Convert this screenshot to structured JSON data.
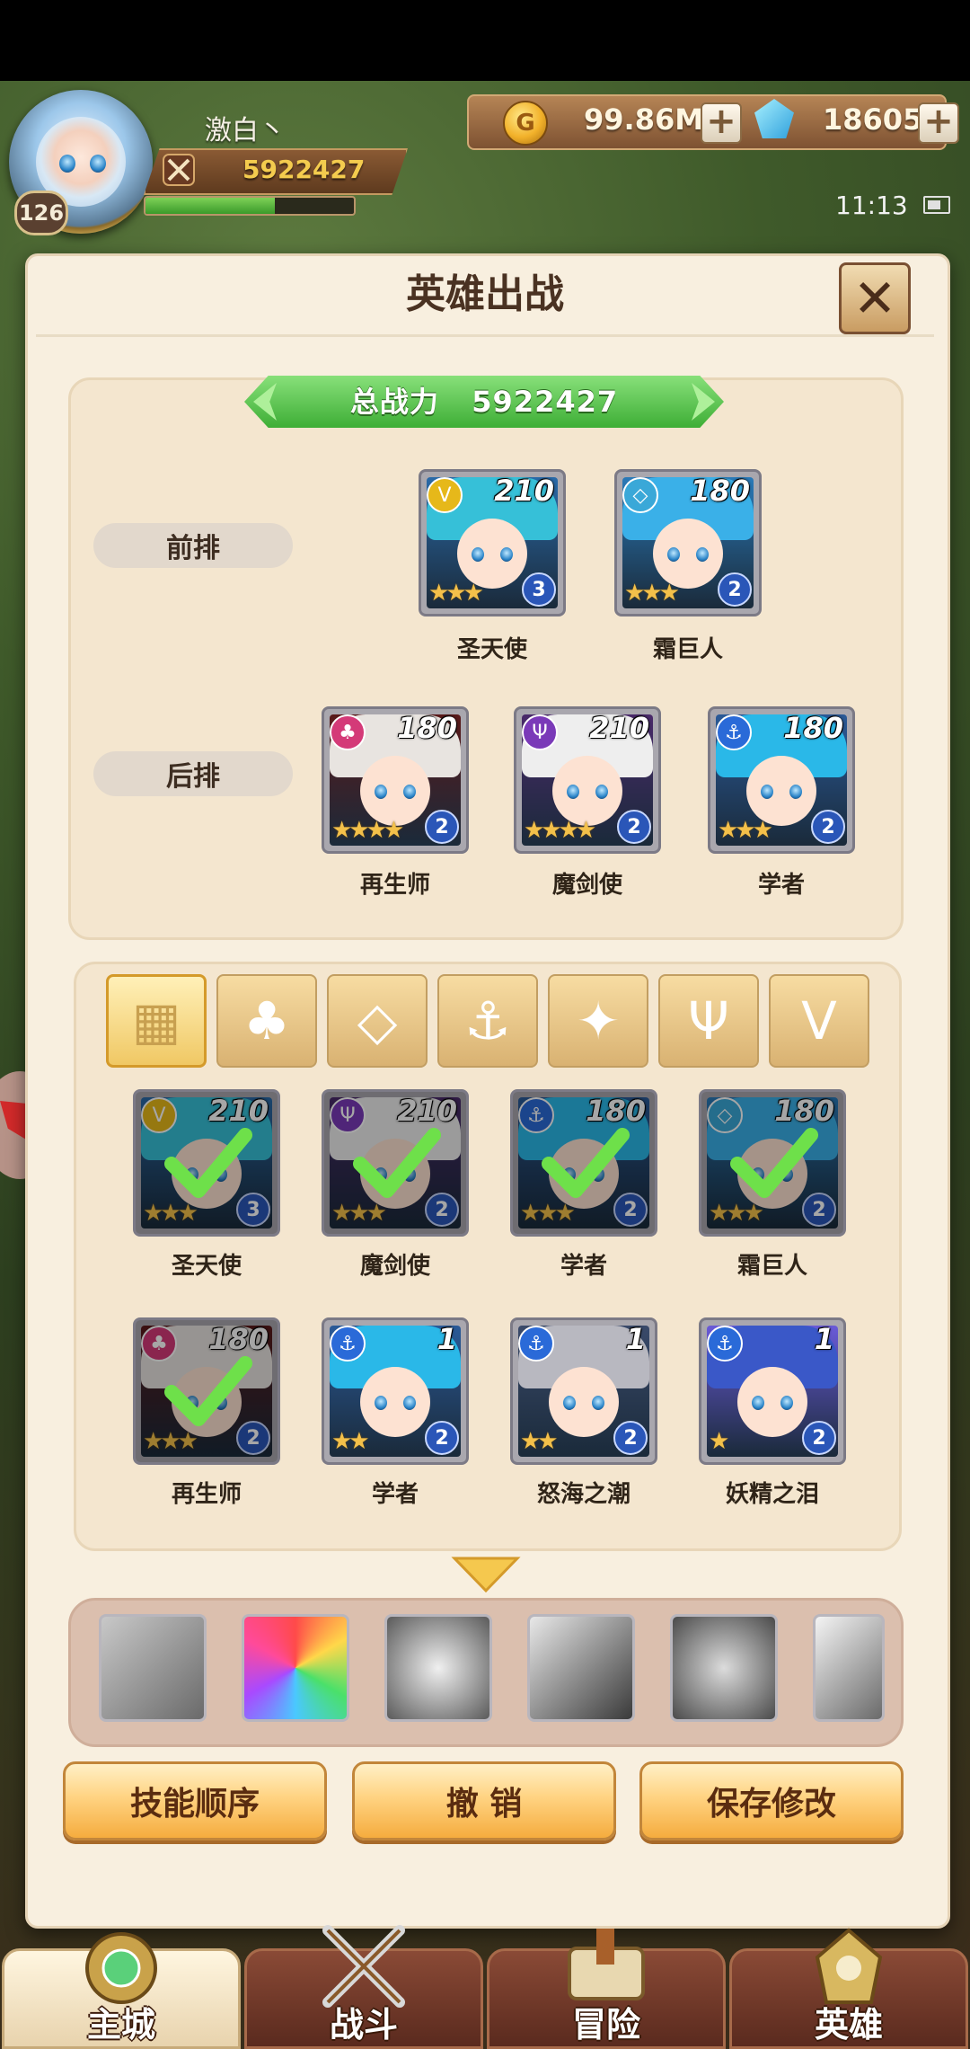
{
  "player": {
    "name": "激白丶",
    "level": "126",
    "power": "5922427",
    "exp_fraction": 0.62
  },
  "resources": {
    "gold": "99.86M",
    "gems": "18605"
  },
  "status": {
    "time": "11:13"
  },
  "dialog": {
    "title": "英雄出战",
    "total_power_label": "总战力",
    "total_power_value": "5922427",
    "front_row_label": "前排",
    "back_row_label": "后排"
  },
  "front_row": [
    {
      "name": "圣天使",
      "level": "210",
      "tier": "3",
      "stars": 3,
      "faction": "light"
    },
    {
      "name": "霜巨人",
      "level": "180",
      "tier": "2",
      "stars": 3,
      "faction": "ice"
    }
  ],
  "back_row": [
    {
      "name": "再生师",
      "level": "180",
      "tier": "2",
      "stars": 4,
      "faction": "nature"
    },
    {
      "name": "魔剑使",
      "level": "210",
      "tier": "2",
      "stars": 4,
      "faction": "dark"
    },
    {
      "name": "学者",
      "level": "180",
      "tier": "2",
      "stars": 3,
      "faction": "water"
    }
  ],
  "filter_tabs": [
    "all-icon",
    "nature-icon",
    "ice-icon",
    "anchor-icon",
    "beast-icon",
    "demon-icon",
    "light-icon"
  ],
  "pool": [
    {
      "name": "圣天使",
      "level": "210",
      "tier": "3",
      "stars": 3,
      "selected": true
    },
    {
      "name": "魔剑使",
      "level": "210",
      "tier": "2",
      "stars": 3,
      "selected": true
    },
    {
      "name": "学者",
      "level": "180",
      "tier": "2",
      "stars": 3,
      "selected": true
    },
    {
      "name": "霜巨人",
      "level": "180",
      "tier": "2",
      "stars": 3,
      "selected": true
    },
    {
      "name": "再生师",
      "level": "180",
      "tier": "2",
      "stars": 3,
      "selected": true
    },
    {
      "name": "学者",
      "level": "1",
      "tier": "2",
      "stars": 2,
      "selected": false
    },
    {
      "name": "怒海之潮",
      "level": "1",
      "tier": "2",
      "stars": 2,
      "selected": false
    },
    {
      "name": "妖精之泪",
      "level": "1",
      "tier": "2",
      "stars": 1,
      "selected": false
    }
  ],
  "skills": [
    "wings-skill-icon",
    "rainbow-burst-skill-icon",
    "shield-skill-icon",
    "blade-skill-icon",
    "armor-skill-icon",
    "wind-skill-icon"
  ],
  "buttons": {
    "skill_order": "技能顺序",
    "undo": "撤 销",
    "save": "保存修改"
  },
  "nav": {
    "main_city": "主城",
    "battle": "战斗",
    "adventure": "冒险",
    "heroes": "英雄"
  },
  "colors": {
    "accent_green": "#3eae36",
    "button_orange": "#f5ac3e",
    "dialog_bg": "#f8efdf"
  }
}
